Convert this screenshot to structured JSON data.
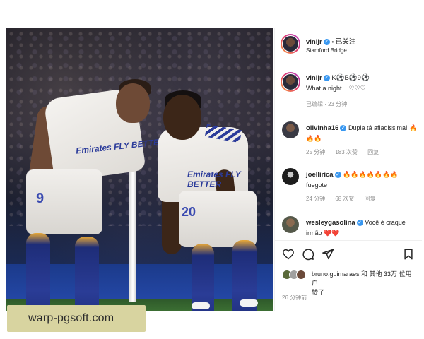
{
  "header": {
    "username": "vinijr",
    "follow_status": "已关注",
    "location": "Stamford Bridge"
  },
  "caption": {
    "username": "vinijr",
    "code": "K⚽B⚽9⚽",
    "text": "What a night... ♡♡♡",
    "meta": "已编辑 · 23 分钟"
  },
  "comments": [
    {
      "username": "olivinha16",
      "text": "Dupla tá afiadissima! 🔥🔥🔥",
      "time": "25 分钟",
      "likes": "183 次赞",
      "reply": "回复"
    },
    {
      "username": "joellirica",
      "emoji": "🔥🔥🔥🔥🔥🔥🔥",
      "text": "fuegote",
      "time": "24 分钟",
      "likes": "68 次赞",
      "reply": "回复"
    },
    {
      "username": "wesleygasolina",
      "text": "Você é craque irmão ❤️❤️"
    }
  ],
  "likes": {
    "text": "bruno.guimaraes 和 其他 33万 位用户",
    "text_end": "赞了",
    "time": "26 分钟前"
  },
  "photo": {
    "jersey_left": "9",
    "jersey_right": "20",
    "sponsor": "Emirates FLY BETTER"
  },
  "watermark": "warp-pgsoft.com",
  "colors": {
    "verified": "#3897f0",
    "meta": "#8e8e8e",
    "heart": "#e0245e"
  }
}
